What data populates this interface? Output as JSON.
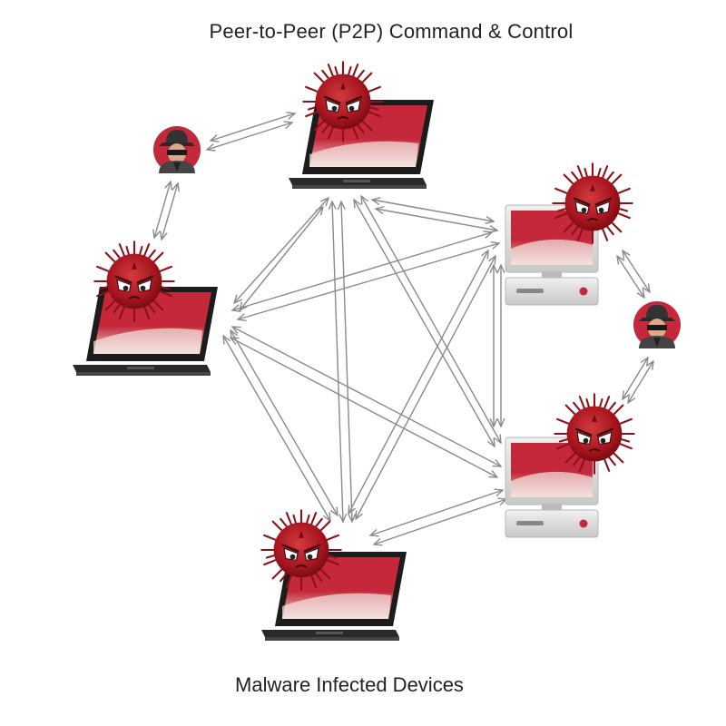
{
  "title": "Peer-to-Peer (P2P) Command & Control",
  "caption": "Malware Infected Devices",
  "colors": {
    "screen_red": "#c4283a",
    "bezel": "#1c1c1c",
    "virus": "#b71c26",
    "arrow": "#8a8a8a",
    "pc_body": "#d8d8d8"
  },
  "nodes": [
    {
      "id": "laptop-top",
      "kind": "laptop",
      "infected": true
    },
    {
      "id": "laptop-left",
      "kind": "laptop",
      "infected": true
    },
    {
      "id": "laptop-bottom",
      "kind": "laptop",
      "infected": true
    },
    {
      "id": "desktop-upper-right",
      "kind": "desktop",
      "infected": true
    },
    {
      "id": "desktop-lower-right",
      "kind": "desktop",
      "infected": true
    },
    {
      "id": "hacker-left",
      "kind": "attacker",
      "icon": "hacker-icon"
    },
    {
      "id": "hacker-right",
      "kind": "attacker",
      "icon": "hacker-icon"
    }
  ]
}
